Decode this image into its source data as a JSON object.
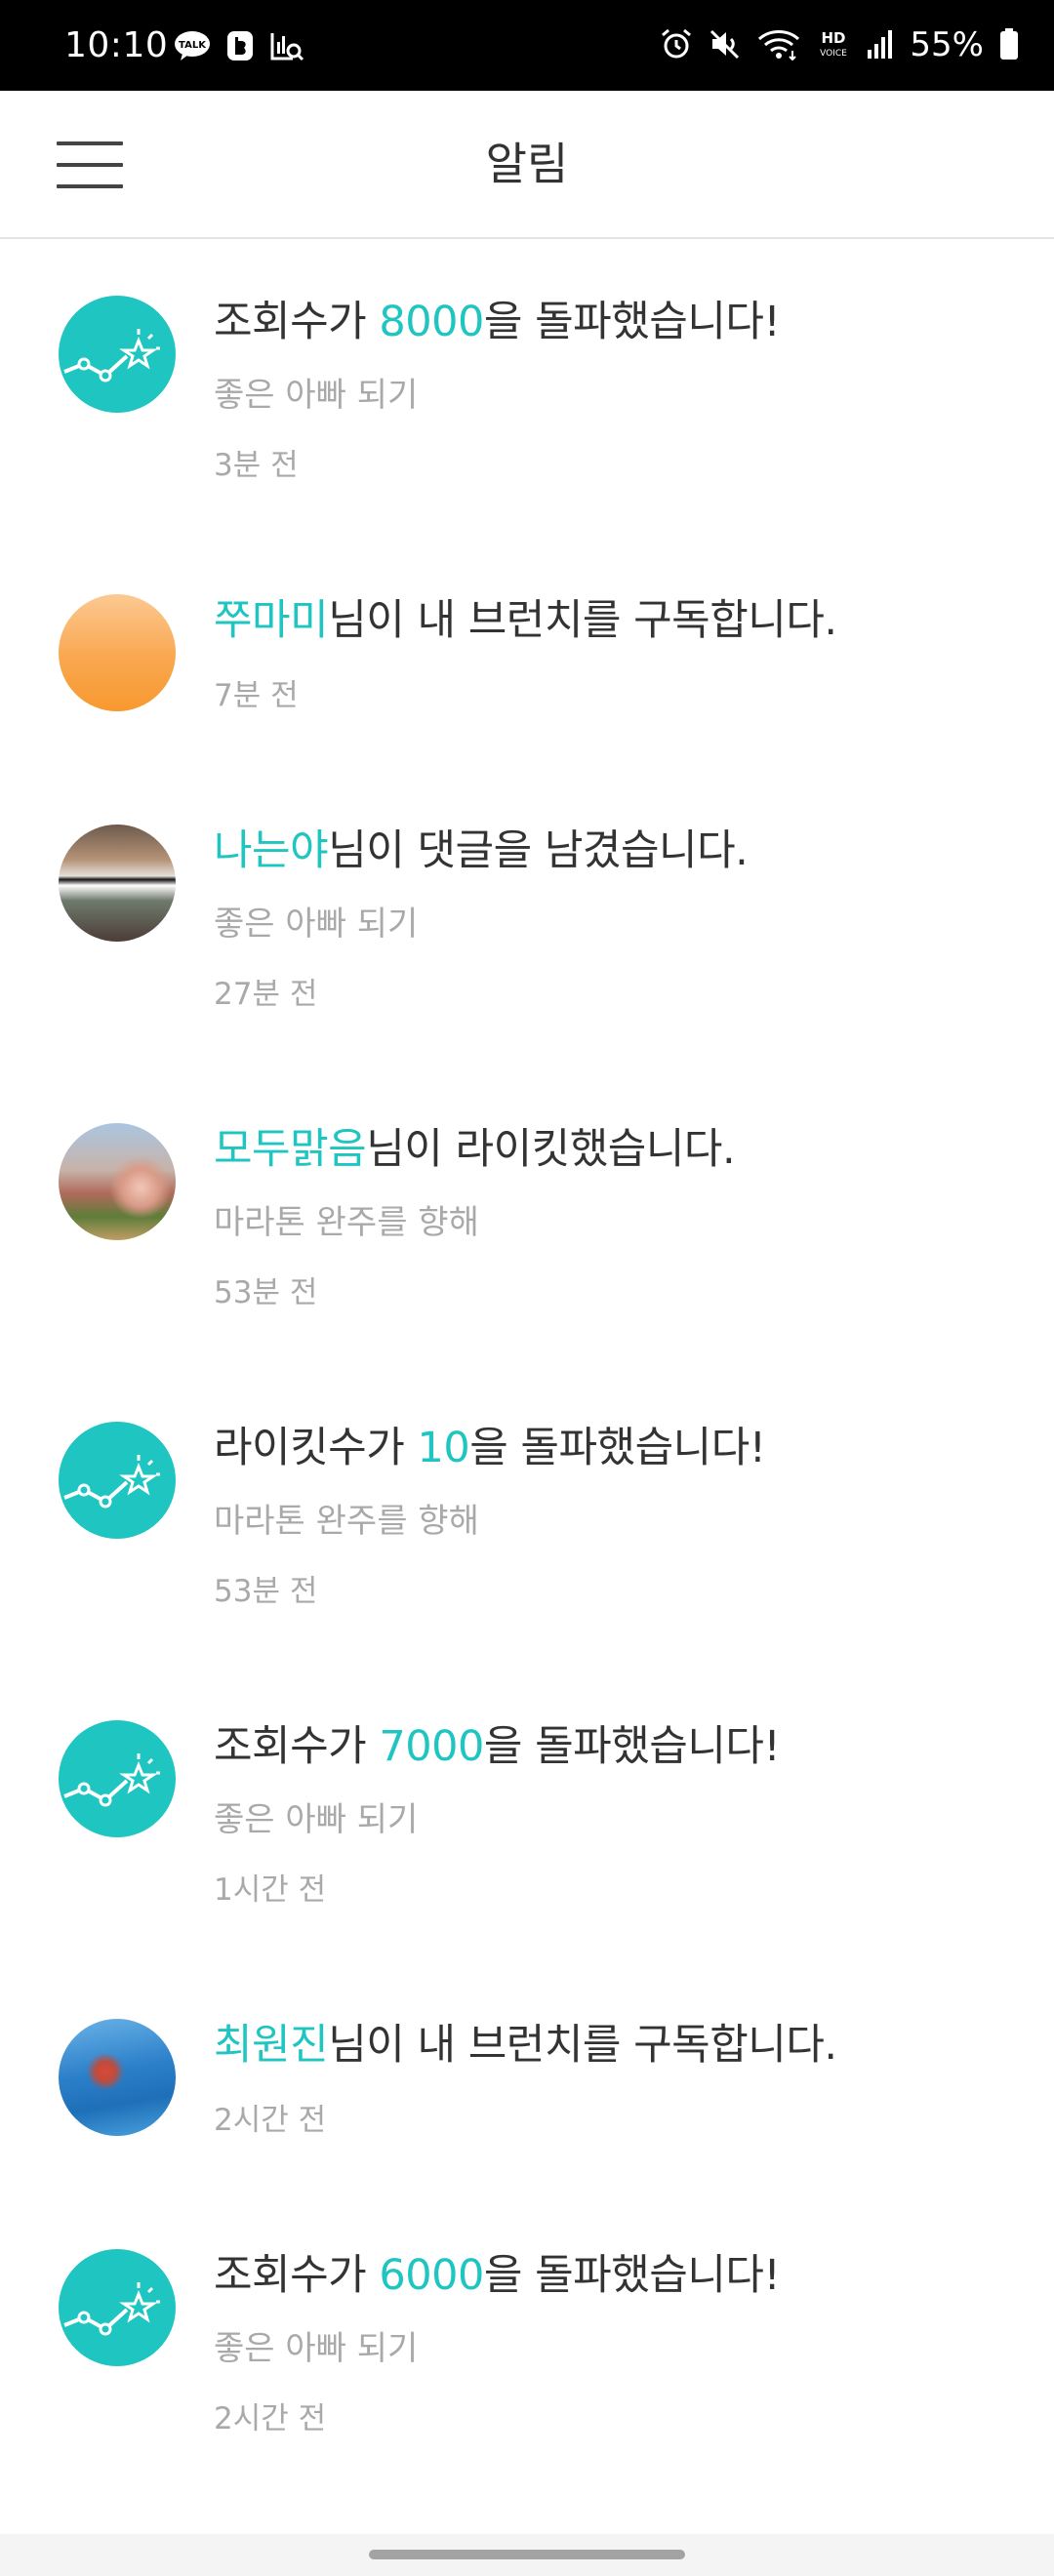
{
  "status_bar": {
    "time": "10:10",
    "battery_text": "55%",
    "left_icons": [
      "kakaotalk-icon",
      "band-icon",
      "stats-search-icon"
    ],
    "right_icons": [
      "alarm-icon",
      "mute-icon",
      "wifi-icon",
      "hd-voice-icon",
      "signal-icon",
      "battery-icon"
    ],
    "hd_label": "HD",
    "voice_label": "VOICE",
    "talk_label": "TALK"
  },
  "header": {
    "title": "알림",
    "menu_icon": "hamburger-menu-icon"
  },
  "colors": {
    "accent": "#1ec5c1",
    "text": "#333333",
    "muted": "#a9a9a9"
  },
  "notifications": [
    {
      "avatar": "milestone-star-icon",
      "pre": "조회수가 ",
      "highlight": "8000",
      "post": "을 돌파했습니다!",
      "subtitle": "좋은 아빠 되기",
      "time": "3분 전"
    },
    {
      "avatar": "orange-avatar",
      "pre": "",
      "highlight": "쭈마미",
      "post": "님이 내 브런치를 구독합니다.",
      "subtitle": "",
      "time": "7분 전"
    },
    {
      "avatar": "photo-avatar",
      "pre": "",
      "highlight": "나는야",
      "post": "님이 댓글을 남겼습니다.",
      "subtitle": "좋은 아빠 되기",
      "time": "27분 전"
    },
    {
      "avatar": "photo-avatar",
      "pre": "",
      "highlight": "모두맑음",
      "post": "님이 라이킷했습니다.",
      "subtitle": "마라톤 완주를 향해",
      "time": "53분 전"
    },
    {
      "avatar": "milestone-star-icon",
      "pre": "라이킷수가 ",
      "highlight": "10",
      "post": "을 돌파했습니다!",
      "subtitle": "마라톤 완주를 향해",
      "time": "53분 전"
    },
    {
      "avatar": "milestone-star-icon",
      "pre": "조회수가 ",
      "highlight": "7000",
      "post": "을 돌파했습니다!",
      "subtitle": "좋은 아빠 되기",
      "time": "1시간 전"
    },
    {
      "avatar": "photo-avatar",
      "pre": "",
      "highlight": "최원진",
      "post": "님이 내 브런치를 구독합니다.",
      "subtitle": "",
      "time": "2시간 전"
    },
    {
      "avatar": "milestone-star-icon",
      "pre": "조회수가 ",
      "highlight": "6000",
      "post": "을 돌파했습니다!",
      "subtitle": "좋은 아빠 되기",
      "time": "2시간 전"
    }
  ]
}
